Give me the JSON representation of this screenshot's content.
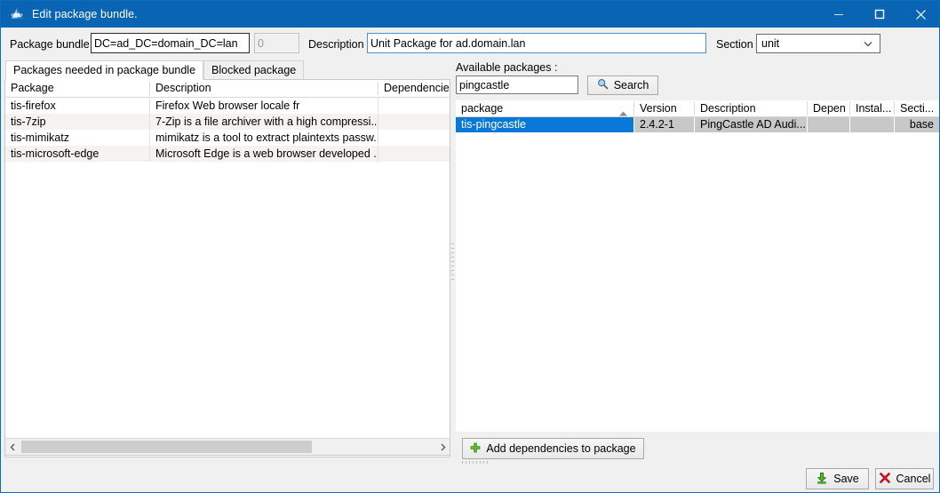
{
  "window": {
    "title": "Edit package bundle.",
    "logo_icon": "wapt-logo-icon",
    "minimize_icon": "minimize-icon",
    "maximize_icon": "maximize-icon",
    "close_icon": "close-icon",
    "titlebar_color": "#0a64b4"
  },
  "form": {
    "package_bundle_label": "Package bundle",
    "package_bundle_value": "DC=ad_DC=domain_DC=lan",
    "counter_value": "0",
    "description_label": "Description",
    "description_value": "Unit Package for ad.domain.lan",
    "section_label": "Section",
    "section_value": "unit",
    "section_options": [
      "unit"
    ],
    "chevron_icon": "chevron-down-icon"
  },
  "tabs": [
    {
      "label": "Packages needed in package bundle",
      "active": true
    },
    {
      "label": "Blocked package",
      "active": false
    }
  ],
  "left_grid": {
    "columns": [
      "Package",
      "Description",
      "Dependencies"
    ],
    "rows": [
      {
        "package": "tis-firefox",
        "description": "Firefox Web browser locale fr",
        "dependencies": ""
      },
      {
        "package": "tis-7zip",
        "description": "7-Zip is a file archiver with a high compressi...",
        "dependencies": ""
      },
      {
        "package": "tis-mimikatz",
        "description": "mimikatz is a tool to extract plaintexts passw...",
        "dependencies": ""
      },
      {
        "package": "tis-microsoft-edge",
        "description": "Microsoft Edge is a web browser developed ...",
        "dependencies": ""
      }
    ],
    "scroll_left_icon": "chevron-left-icon",
    "scroll_right_icon": "chevron-right-icon"
  },
  "right_panel": {
    "available_label": "Available packages :",
    "search_value": "pingcastle",
    "search_placeholder": "",
    "search_button_label": "Search",
    "search_icon": "search-icon",
    "columns": [
      "package",
      "Version",
      "Description",
      "Depen",
      "Instal...",
      "Secti..."
    ],
    "sort_column": "package",
    "sort_icon": "sort-ascending-icon",
    "rows": [
      {
        "package": "tis-pingcastle",
        "version": "2.4.2-1",
        "description": "PingCastle AD Audi...",
        "depends": "",
        "install": "",
        "section": "base",
        "selected": true
      }
    ]
  },
  "footer": {
    "add_dependencies_label": "Add dependencies to package",
    "add_icon": "plus-icon",
    "save_label": "Save",
    "save_icon": "save-download-icon",
    "cancel_label": "Cancel",
    "cancel_icon": "cancel-x-icon"
  }
}
